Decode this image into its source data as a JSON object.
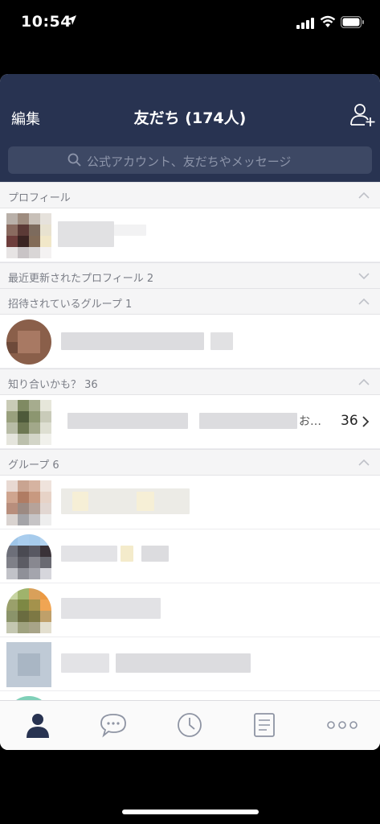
{
  "status_bar": {
    "time": "10:54",
    "icons": [
      "location-arrow-icon",
      "signal-icon",
      "wifi-icon",
      "battery-icon"
    ]
  },
  "header": {
    "edit_label": "編集",
    "title": "友だち (174人)",
    "add_friend_icon": "add-friend-icon",
    "background_color": "#283351"
  },
  "search": {
    "placeholder": "公式アカウント、友だちやメッセージ",
    "icon": "search-icon"
  },
  "sections": {
    "profile": {
      "label": "プロフィール",
      "state": "expanded"
    },
    "recent_updates": {
      "label": "最近更新されたプロフィール 2",
      "state": "collapsed"
    },
    "invited_groups": {
      "label": "招待されているグループ 1",
      "state": "expanded"
    },
    "suggestions": {
      "label": "知り合いかも？ 36",
      "state": "expanded",
      "row_ellipsis": "お…",
      "row_count": "36"
    },
    "groups": {
      "label": "グループ 6",
      "state": "expanded"
    }
  },
  "tabbar": {
    "tabs": [
      {
        "name": "friends",
        "icon": "person-icon",
        "active": true
      },
      {
        "name": "chats",
        "icon": "chat-bubble-icon",
        "active": false
      },
      {
        "name": "timeline",
        "icon": "clock-icon",
        "active": false
      },
      {
        "name": "news",
        "icon": "news-icon",
        "active": false
      },
      {
        "name": "more",
        "icon": "more-icon",
        "active": false
      }
    ]
  },
  "colors": {
    "accent": "#283351",
    "section_bg": "#f5f5f6",
    "section_text": "#7a7d86"
  }
}
